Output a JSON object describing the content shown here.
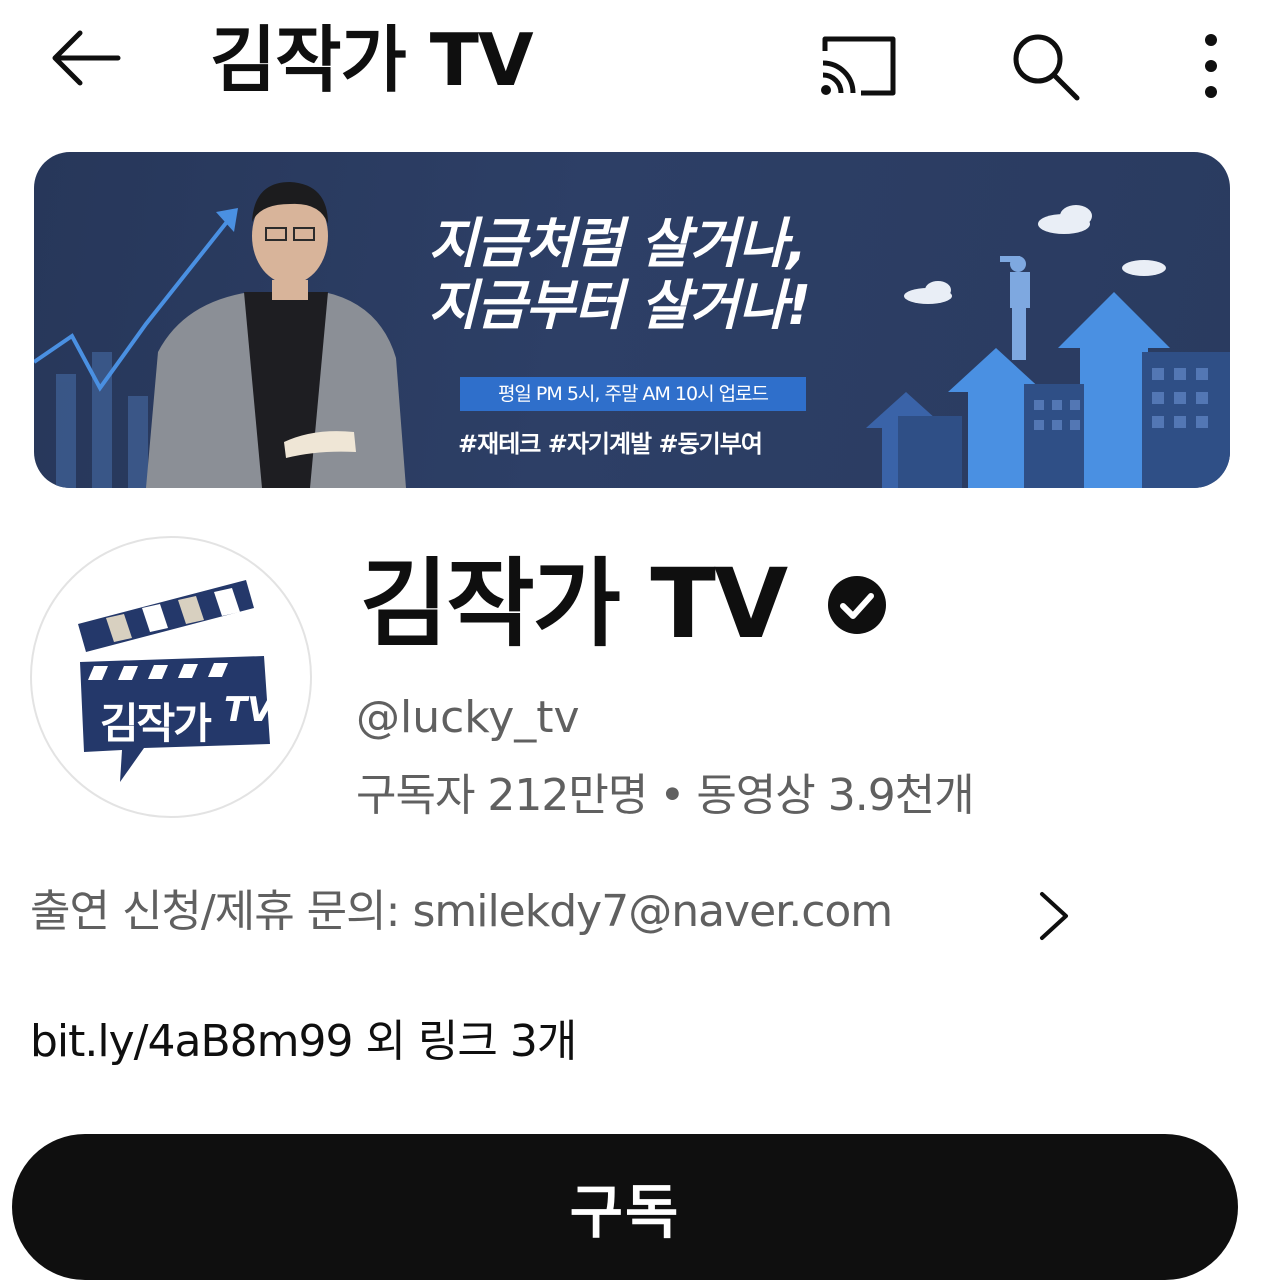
{
  "header": {
    "title": "김작가 TV",
    "icons": [
      "back-arrow-icon",
      "cast-icon",
      "search-icon",
      "more-vert-icon"
    ]
  },
  "banner": {
    "headline_line1": "지금처럼 살거나,",
    "headline_line2": "지금부터 살거나!",
    "schedule": "평일 PM 5시, 주말 AM 10시 업로드",
    "hashtags": "#재테크 #자기계발 #동기부여",
    "colors": {
      "background": "#2a3b60",
      "accent_blue": "#2f6fcb",
      "arrow_blue": "#4a90e2"
    }
  },
  "channel": {
    "avatar_text": "김작가",
    "avatar_text_tv": "TV",
    "name": "김작가 TV",
    "verified": true,
    "handle": "@lucky_tv",
    "subscribers": "구독자 212만명",
    "separator": "•",
    "videos": "동영상 3.9천개"
  },
  "description": {
    "text": "출연 신청/제휴 문의: smilekdy7@naver.com"
  },
  "links": {
    "text": "bit.ly/4aB8m99 외 링크 3개"
  },
  "subscribe": {
    "label": "구독",
    "color": "#0f0f0f"
  }
}
